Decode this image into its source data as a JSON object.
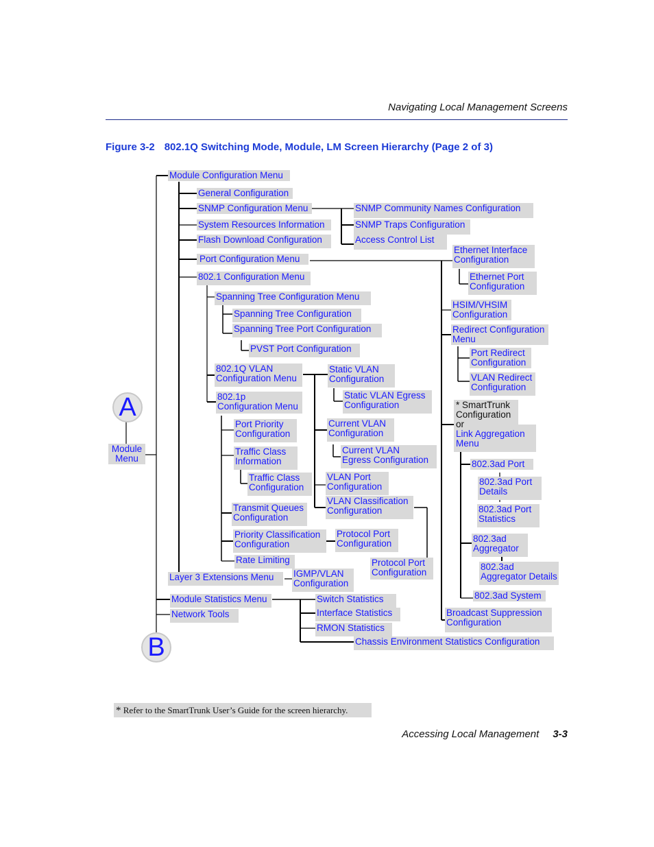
{
  "page": {
    "running_head": "Navigating Local Management Screens",
    "figure_number": "Figure 3-2",
    "figure_title": "802.1Q Switching Mode, Module, LM Screen Hierarchy (Page 2 of 3)",
    "footnote_mark": "*",
    "footnote_text": "Refer to the SmartTrunk User’s Guide for the screen hierarchy.",
    "footer_section": "Accessing Local Management",
    "footer_page": "3-3"
  },
  "connectors": {
    "a": "A",
    "b": "B"
  },
  "nodes": {
    "module_menu": "Module\nMenu",
    "module_config_menu": "Module Configuration Menu",
    "general_config": "General Configuration",
    "snmp_config_menu": "SNMP Configuration Menu",
    "snmp_community": "SNMP Community Names Configuration",
    "snmp_traps": "SNMP Traps Configuration",
    "access_control": "Access Control List",
    "system_resources": "System Resources Information",
    "flash_download": "Flash Download Configuration",
    "port_config_menu": "Port Configuration Menu",
    "ethernet_interface": "Ethernet Interface\nConfiguration",
    "ethernet_port": "Ethernet Port\nConfiguration",
    "hsim_vhsim": "HSIM/VHSIM\nConfiguration",
    "redirect_menu": "Redirect Configuration\nMenu",
    "port_redirect": "Port Redirect\nConfiguration",
    "vlan_redirect": "VLAN Redirect\nConfiguration",
    "smarttrunk_prefix": "* SmartTrunk\nConfiguration\nor",
    "link_aggregation": "Link Aggregation\nMenu",
    "ad_port": "802.3ad Port",
    "ad_port_details": "802.3ad Port\nDetails",
    "ad_port_stats": "802.3ad Port\nStatistics",
    "ad_aggregator": "802.3ad\nAggregator",
    "ad_aggregator_details": "802.3ad\nAggregator Details",
    "ad_system": "802.3ad System",
    "broadcast_suppression": "Broadcast Suppression\nConfiguration",
    "dot1_config_menu": "802.1 Configuration Menu",
    "stp_menu": "Spanning Tree Configuration Menu",
    "stp_config": "Spanning Tree Configuration",
    "stp_port_config": "Spanning Tree Port Configuration",
    "pvst_port": "PVST Port Configuration",
    "dot1q_vlan_menu": "802.1Q VLAN\nConfiguration Menu",
    "static_vlan": "Static VLAN\nConfiguration",
    "static_vlan_egress": "Static VLAN Egress\nConfiguration",
    "current_vlan": "Current VLAN\nConfiguration",
    "current_vlan_egress": "Current VLAN\nEgress Configuration",
    "vlan_port": "VLAN Port\nConfiguration",
    "vlan_classification": "VLAN Classification\nConfiguration",
    "protocol_port_b": "Protocol Port\nConfiguration",
    "dot1p_menu": "802.1p\nConfiguration Menu",
    "port_priority": "Port Priority\nConfiguration",
    "traffic_class_info": "Traffic Class\nInformation",
    "traffic_class_config": "Traffic Class\nConfiguration",
    "transmit_queues": "Transmit Queues\nConfiguration",
    "priority_classification": "Priority Classification\nConfiguration",
    "protocol_port_a": "Protocol Port\nConfiguration",
    "rate_limiting": "Rate Limiting",
    "layer3_menu": "Layer 3 Extensions Menu",
    "igmp_vlan": "IGMP/VLAN\nConfiguration",
    "module_stats_menu": "Module Statistics Menu",
    "switch_stats": "Switch Statistics",
    "interface_stats": "Interface Statistics",
    "rmon_stats": "RMON Statistics",
    "chassis_env": "Chassis Environment Statistics Configuration",
    "network_tools": "Network Tools"
  }
}
